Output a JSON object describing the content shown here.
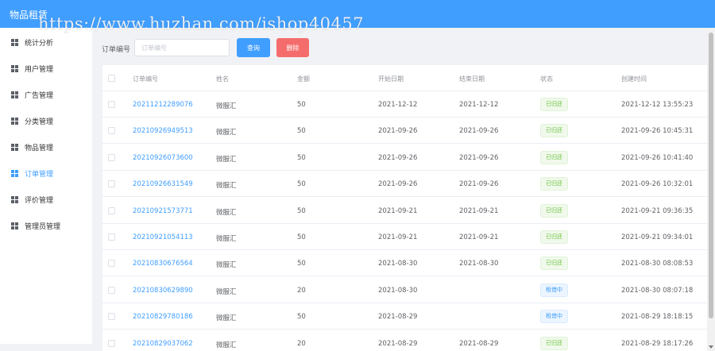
{
  "header": {
    "title": "物品租赁"
  },
  "watermark": "https://www.huzhan.com/ishop40457",
  "sidebar": {
    "items": [
      {
        "label": "统计分析",
        "active": false
      },
      {
        "label": "用户管理",
        "active": false
      },
      {
        "label": "广告管理",
        "active": false
      },
      {
        "label": "分类管理",
        "active": false
      },
      {
        "label": "物品管理",
        "active": false
      },
      {
        "label": "订单管理",
        "active": true
      },
      {
        "label": "评价管理",
        "active": false
      },
      {
        "label": "管理员管理",
        "active": false
      }
    ]
  },
  "search": {
    "label": "订单编号",
    "placeholder": "订单编号",
    "value": "",
    "query_button": "查询",
    "delete_button": "删除"
  },
  "table": {
    "columns": [
      "订单编号",
      "姓名",
      "金额",
      "开始日期",
      "结束日期",
      "状态",
      "创建时间"
    ],
    "rows": [
      {
        "order_no": "20211212289076",
        "name": "微服汇",
        "amount": "50",
        "start": "2021-12-12",
        "end": "2021-12-12",
        "status": "已归还",
        "status_type": "success",
        "created": "2021-12-12 13:55:23"
      },
      {
        "order_no": "20210926949513",
        "name": "微服汇",
        "amount": "50",
        "start": "2021-09-26",
        "end": "2021-09-26",
        "status": "已归还",
        "status_type": "success",
        "created": "2021-09-26 10:45:31"
      },
      {
        "order_no": "20210926073600",
        "name": "微服汇",
        "amount": "50",
        "start": "2021-09-26",
        "end": "2021-09-26",
        "status": "已归还",
        "status_type": "success",
        "created": "2021-09-26 10:41:40"
      },
      {
        "order_no": "20210926631549",
        "name": "微服汇",
        "amount": "50",
        "start": "2021-09-26",
        "end": "2021-09-26",
        "status": "已归还",
        "status_type": "success",
        "created": "2021-09-26 10:32:01"
      },
      {
        "order_no": "20210921573771",
        "name": "微服汇",
        "amount": "50",
        "start": "2021-09-21",
        "end": "2021-09-21",
        "status": "已归还",
        "status_type": "success",
        "created": "2021-09-21 09:36:35"
      },
      {
        "order_no": "20210921054113",
        "name": "微服汇",
        "amount": "50",
        "start": "2021-09-21",
        "end": "2021-09-21",
        "status": "已归还",
        "status_type": "success",
        "created": "2021-09-21 09:34:01"
      },
      {
        "order_no": "20210830676564",
        "name": "微服汇",
        "amount": "50",
        "start": "2021-08-30",
        "end": "2021-08-30",
        "status": "已归还",
        "status_type": "success",
        "created": "2021-08-30 08:08:53"
      },
      {
        "order_no": "20210830629890",
        "name": "微服汇",
        "amount": "20",
        "start": "2021-08-30",
        "end": "",
        "status": "租借中",
        "status_type": "info",
        "created": "2021-08-30 08:07:18"
      },
      {
        "order_no": "20210829780186",
        "name": "微服汇",
        "amount": "50",
        "start": "2021-08-29",
        "end": "",
        "status": "租借中",
        "status_type": "info",
        "created": "2021-08-29 18:18:15"
      },
      {
        "order_no": "20210829037062",
        "name": "微服汇",
        "amount": "20",
        "start": "2021-08-29",
        "end": "2021-08-29",
        "status": "已归还",
        "status_type": "success",
        "created": "2021-08-29 18:17:26"
      }
    ]
  },
  "colors": {
    "header": "#409eff",
    "primary": "#409eff",
    "danger": "#f56c6c",
    "success": "#67c23a"
  }
}
